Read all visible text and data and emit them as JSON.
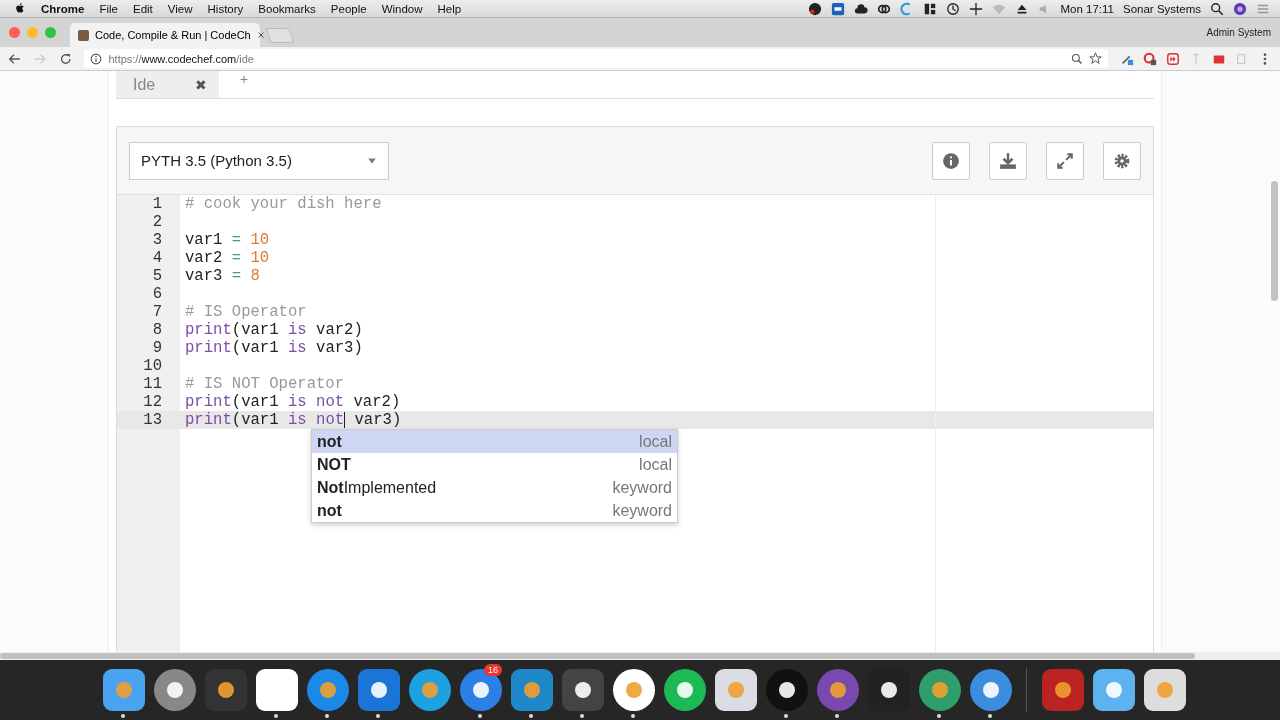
{
  "menu_bar": {
    "app": "Chrome",
    "items": [
      "File",
      "Edit",
      "View",
      "History",
      "Bookmarks",
      "People",
      "Window",
      "Help"
    ],
    "clock": "Mon 17:11",
    "user": "Sonar Systems"
  },
  "browser": {
    "tab_title": "Code, Compile & Run | CodeCh",
    "profile": "Admin System",
    "url_scheme": "https://",
    "url_host": "www.codechef.com",
    "url_path": "/ide"
  },
  "page_tabs": [
    {
      "label": "Ide",
      "close": "✖"
    },
    {
      "label": "+"
    }
  ],
  "editor": {
    "language": "PYTH 3.5 (Python 3.5)",
    "lines": [
      {
        "number": "1",
        "active": false,
        "tokens": [
          {
            "text": "# cook your dish here",
            "kind": "comment"
          }
        ]
      },
      {
        "number": "2",
        "active": false
      },
      {
        "number": "3",
        "active": false,
        "tokens": [
          {
            "text": "var1 ",
            "kind": "plain"
          },
          {
            "text": "=",
            "kind": "operator"
          },
          {
            "text": " 10",
            "kind": "number"
          }
        ]
      },
      {
        "number": "4",
        "active": false,
        "tokens": [
          {
            "text": "var2 ",
            "kind": "plain"
          },
          {
            "text": "=",
            "kind": "operator"
          },
          {
            "text": " 10",
            "kind": "number"
          }
        ]
      },
      {
        "number": "5",
        "active": false,
        "tokens": [
          {
            "text": "var3 ",
            "kind": "plain"
          },
          {
            "text": "=",
            "kind": "operator"
          },
          {
            "text": " 8",
            "kind": "number"
          }
        ]
      },
      {
        "number": "6",
        "active": false
      },
      {
        "number": "7",
        "active": false,
        "tokens": [
          {
            "text": "# IS Operator",
            "kind": "comment"
          }
        ]
      },
      {
        "number": "8",
        "active": false,
        "tokens": [
          {
            "text": "print",
            "kind": "keyword"
          },
          {
            "text": "(var1 ",
            "kind": "plain"
          },
          {
            "text": "is",
            "kind": "keyword"
          },
          {
            "text": " var2)",
            "kind": "plain"
          }
        ]
      },
      {
        "number": "9",
        "active": false,
        "tokens": [
          {
            "text": "print",
            "kind": "keyword"
          },
          {
            "text": "(var1 ",
            "kind": "plain"
          },
          {
            "text": "is",
            "kind": "keyword"
          },
          {
            "text": " var3)",
            "kind": "plain"
          }
        ]
      },
      {
        "number": "10",
        "active": false
      },
      {
        "number": "11",
        "active": false,
        "tokens": [
          {
            "text": "# IS NOT Operator",
            "kind": "comment"
          }
        ]
      },
      {
        "number": "12",
        "active": false,
        "tokens": [
          {
            "text": "print",
            "kind": "keyword"
          },
          {
            "text": "(var1 ",
            "kind": "plain"
          },
          {
            "text": "is",
            "kind": "keyword"
          },
          {
            "text": " not",
            "kind": "keyword"
          },
          {
            "text": " var2)",
            "kind": "plain"
          }
        ]
      },
      {
        "number": "13",
        "active": true,
        "tokens": [
          {
            "text": "print",
            "kind": "keyword"
          },
          {
            "text": "(var1 ",
            "kind": "plain"
          },
          {
            "text": "is",
            "kind": "keyword"
          },
          {
            "text": " not",
            "kind": "keyword",
            "cursor_after": true
          },
          {
            "text": " var3)",
            "kind": "plain"
          }
        ]
      }
    ],
    "autocomplete": [
      {
        "match": "not",
        "type": "local",
        "selected": true
      },
      {
        "match": "NOT",
        "type": "local",
        "selected": false
      },
      {
        "match": "Not",
        "rest": "Implemented",
        "type": "keyword",
        "selected": false
      },
      {
        "match": "not",
        "type": "keyword",
        "selected": false
      }
    ]
  },
  "dock": [
    {
      "running": true
    },
    {
      "running": false
    },
    {
      "running": false
    },
    {
      "running": true
    },
    {
      "running": true
    },
    {
      "running": true
    },
    {
      "running": false
    },
    {
      "running": true,
      "badge": "16"
    },
    {
      "running": true
    },
    {
      "running": true
    },
    {
      "running": true
    },
    {
      "running": false
    },
    {
      "running": false
    },
    {
      "running": true
    },
    {
      "running": true
    },
    {
      "running": false
    },
    {
      "running": true
    },
    {
      "running": true
    },
    {
      "running": false
    },
    {
      "running": false
    },
    {
      "running": false
    }
  ]
}
